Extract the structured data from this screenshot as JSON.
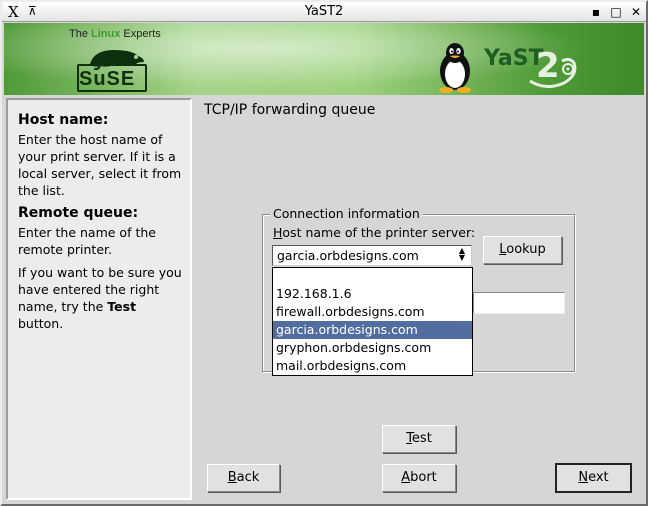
{
  "window": {
    "title": "YaST2",
    "close_glyph": "X",
    "pin_glyph": "⊼",
    "min_glyph": "▪",
    "max_glyph": "□",
    "closebtn_glyph": "✕"
  },
  "banner": {
    "tagline_pre": "The ",
    "tagline_brand": "Linux",
    "tagline_post": " Experts",
    "suse_wordmark": "SuSE",
    "yast_logo_text": "YaST",
    "yast_logo_number": "2",
    "colors": {
      "green_dark": "#3e8a2a",
      "green_light": "#a6d48a"
    }
  },
  "help": {
    "host_heading": "Host name:",
    "host_text": "Enter the host name of your print server. If it is a local server, select it from the list.",
    "queue_heading": "Remote queue:",
    "queue_text": "Enter the name of the remote printer.",
    "test_text_pre": "If you want to be sure you have entered the right name, try the ",
    "test_text_bold": "Test",
    "test_text_post": " button."
  },
  "main": {
    "title": "TCP/IP forwarding queue",
    "group_legend": "Connection information",
    "host_label_access": "H",
    "host_label_rest": "ost name of the printer server:",
    "host_value": "garcia.orbdesigns.com",
    "host_options": [
      {
        "label": "",
        "selected": false
      },
      {
        "label": "192.168.1.6",
        "selected": false
      },
      {
        "label": "firewall.orbdesigns.com",
        "selected": false
      },
      {
        "label": "garcia.orbdesigns.com",
        "selected": true
      },
      {
        "label": "gryphon.orbdesigns.com",
        "selected": false
      },
      {
        "label": "mail.orbdesigns.com",
        "selected": false
      }
    ],
    "remote_queue_value": ""
  },
  "buttons": {
    "lookup_access": "L",
    "lookup_rest": "ookup",
    "test_access": "T",
    "test_rest": "est",
    "back_access": "B",
    "back_rest": "ack",
    "abort_access": "A",
    "abort_rest": "bort",
    "next_access": "N",
    "next_rest": "ext"
  },
  "colors": {
    "window_bg": "#d6d6d6",
    "help_bg": "#ececec",
    "selection": "#526da0"
  },
  "icons": [
    "x-window-icon",
    "pin-icon",
    "minimize-icon",
    "maximize-icon",
    "close-icon",
    "chameleon-icon",
    "tux-icon",
    "yast-logo-icon",
    "combo-arrow-icon"
  ]
}
